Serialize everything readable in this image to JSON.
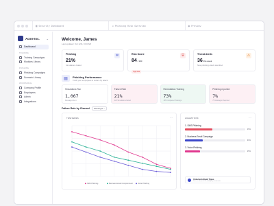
{
  "browser": {
    "tabs": [
      {
        "icon": "grid-icon",
        "label": "Security Dashboard"
      },
      {
        "icon": "fish-icon",
        "label": "Phishing Risk Overview"
      },
      {
        "icon": "eye-icon",
        "label": "Preview"
      }
    ],
    "dot_colors": [
      "#e0e0e6",
      "#e0e0e6",
      "#e0e0e6"
    ]
  },
  "sidebar": {
    "brand": "Acme Inc.",
    "dashboard": "Dashboard",
    "sections": [
      {
        "heading": "TRAINING",
        "items": [
          "Training Campaigns",
          "Modules Library"
        ]
      },
      {
        "heading": "PHISHING",
        "items": [
          "Phishing Campaigns",
          "Scenario Library"
        ]
      },
      {
        "heading": "WORKSPACE",
        "items": [
          "Company Profile",
          "Employees",
          "Admin",
          "Integrations"
        ]
      }
    ]
  },
  "header": {
    "title": "Welcome, James",
    "updated": "Last updated: Oct 12th, 9:00 AM"
  },
  "top_cards": [
    {
      "title": "Phishing",
      "value": "21%",
      "suffix": "",
      "sub": "Simulations Failed",
      "badge": "",
      "icon": "fish-icon",
      "icon_bg": "#eef0fb",
      "icon_color": "#3b47c9"
    },
    {
      "title": "Risk Score",
      "value": "84",
      "suffix": "/ 100",
      "sub": "",
      "badge": "High Risk",
      "icon": "shield-icon",
      "icon_bg": "#fdecec",
      "icon_color": "#d93b3b"
    },
    {
      "title": "Threat Alerts",
      "value": "36",
      "suffix": "this week",
      "sub": "New phishing attack identified",
      "badge": "",
      "icon": "alert-icon",
      "icon_bg": "#fff1e4",
      "icon_color": "#e07a1e"
    }
  ],
  "performance": {
    "title": "Phishing Performance",
    "subtitle": "Track your employees & reduce by attack"
  },
  "stats": [
    {
      "label": "Simulations Run",
      "value": "1,067",
      "sub": "Messages Sent",
      "bg": "#ffffff"
    },
    {
      "label": "Failure Rate",
      "value": "21%",
      "sub": "226 Simulations Failed",
      "bg": "#fdf0f4"
    },
    {
      "label": "Remediation Training",
      "value": "73%",
      "sub": "165 Completed Trainings",
      "bg": "#eef8f3"
    },
    {
      "label": "Phishing reported",
      "value": "7%",
      "sub": "75 Messages Reported",
      "bg": "#fdf0f4"
    }
  ],
  "failure_rate": {
    "title": "Failure Rate by Channel",
    "select": "Attack Type"
  },
  "chart_data": {
    "type": "line",
    "title": "TIME SERIES",
    "x": [
      "1",
      "2",
      "3",
      "4",
      "5",
      "6",
      "7",
      "8"
    ],
    "ylim": [
      0,
      100
    ],
    "series": [
      {
        "name": "SMS Phishing",
        "color": "#e0388f",
        "values": [
          88,
          80,
          72,
          62,
          48,
          38,
          24,
          16
        ]
      },
      {
        "name": "Business Email Compromised",
        "color": "#2eb398",
        "values": [
          68,
          58,
          50,
          38,
          32,
          26,
          20,
          14
        ]
      },
      {
        "name": "Voice Phishing",
        "color": "#6a5ad8",
        "values": [
          58,
          48,
          38,
          30,
          22,
          14,
          10,
          8
        ]
      }
    ]
  },
  "ranking": {
    "title": "HIGHEST RISK",
    "items": [
      {
        "label": "1. SMS Phishing",
        "percent": 45,
        "value": "45%",
        "color": "#e44d5e"
      },
      {
        "label": "2. Business Email Campaign",
        "percent": 30,
        "value": "30%",
        "color": "#3b47c9"
      },
      {
        "label": "3. Voice Phishing",
        "percent": 25,
        "value": "25%",
        "color": "#e0388f"
      }
    ],
    "note_title": "Unlocked Attack Types",
    "note_sub": "Discuss about all Phishing Improvements"
  }
}
